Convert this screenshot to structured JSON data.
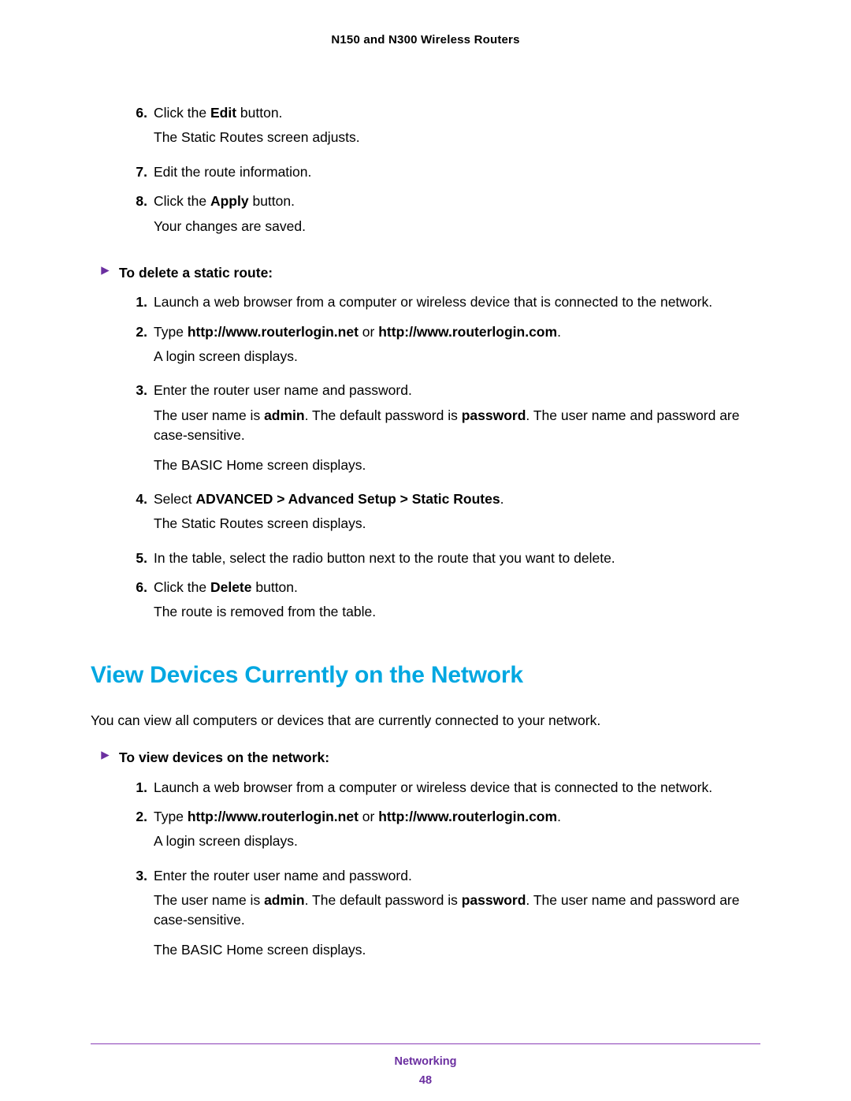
{
  "header": {
    "title": "N150 and N300 Wireless Routers"
  },
  "top_steps": {
    "s6": {
      "num": "6.",
      "line_a": "Click the ",
      "bold_a": "Edit",
      "line_b": " button.",
      "follow": "The Static Routes screen adjusts."
    },
    "s7": {
      "num": "7.",
      "text": "Edit the route information."
    },
    "s8": {
      "num": "8.",
      "line_a": "Click the ",
      "bold_a": "Apply",
      "line_b": " button.",
      "follow": "Your changes are saved."
    }
  },
  "delete_section": {
    "heading": "To delete a static route:",
    "s1": {
      "num": "1.",
      "text": "Launch a web browser from a computer or wireless device that is connected to the network."
    },
    "s2": {
      "num": "2.",
      "pre": "Type ",
      "b1": "http://www.routerlogin.net",
      "mid": " or ",
      "b2": "http://www.routerlogin.com",
      "post": ".",
      "follow": "A login screen displays."
    },
    "s3": {
      "num": "3.",
      "text": "Enter the router user name and password.",
      "p2a": "The user name is ",
      "p2b": "admin",
      "p2c": ". The default password is ",
      "p2d": "password",
      "p2e": ". The user name and password are case-sensitive.",
      "p3": "The BASIC Home screen displays."
    },
    "s4": {
      "num": "4.",
      "pre": "Select ",
      "b1": "ADVANCED > Advanced Setup > Static Routes",
      "post": ".",
      "follow": "The Static Routes screen displays."
    },
    "s5": {
      "num": "5.",
      "text": "In the table, select the radio button next to the route that you want to delete."
    },
    "s6": {
      "num": "6.",
      "line_a": "Click the ",
      "bold_a": "Delete",
      "line_b": " button.",
      "follow": "The route is removed from the table."
    }
  },
  "section_heading": "View Devices Currently on the Network",
  "section_intro": "You can view all computers or devices that are currently connected to your network.",
  "view_section": {
    "heading": "To view devices on the network:",
    "s1": {
      "num": "1.",
      "text": "Launch a web browser from a computer or wireless device that is connected to the network."
    },
    "s2": {
      "num": "2.",
      "pre": "Type ",
      "b1": "http://www.routerlogin.net",
      "mid": " or ",
      "b2": "http://www.routerlogin.com",
      "post": ".",
      "follow": "A login screen displays."
    },
    "s3": {
      "num": "3.",
      "text": "Enter the router user name and password.",
      "p2a": "The user name is ",
      "p2b": "admin",
      "p2c": ". The default password is ",
      "p2d": "password",
      "p2e": ". The user name and password are case-sensitive.",
      "p3": "The BASIC Home screen displays."
    }
  },
  "footer": {
    "label": "Networking",
    "page": "48"
  }
}
